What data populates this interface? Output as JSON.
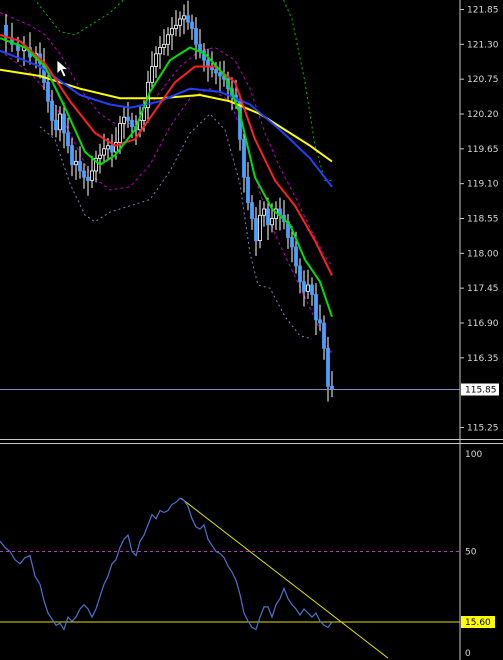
{
  "chart_data": [
    {
      "type": "candlestick",
      "panel": "price",
      "ylim": [
        115.1,
        122.0
      ],
      "yticks": [
        "121.85",
        "121.30",
        "120.75",
        "120.20",
        "119.65",
        "119.10",
        "118.55",
        "118.00",
        "117.45",
        "116.90",
        "116.35",
        "115.85",
        "115.25"
      ],
      "current_price": "115.85",
      "current_price_value": 115.85,
      "colors": {
        "background": "#000000",
        "candle": "#ffffff",
        "bollinger": "#00c000",
        "envelope": "#c000c0",
        "ema_fast": "#00e000",
        "ema_mid": "#ff2020",
        "ma_slow": "#2040ff",
        "ma_long": "#ffff00",
        "price_line": "#7f8fbf"
      },
      "close_path": [
        [
          0,
          121.6
        ],
        [
          6,
          121.4
        ],
        [
          12,
          121.3
        ],
        [
          18,
          121.2
        ],
        [
          24,
          121.25
        ],
        [
          30,
          121.1
        ],
        [
          36,
          121.15
        ],
        [
          40,
          121.0
        ],
        [
          44,
          120.7
        ],
        [
          48,
          120.4
        ],
        [
          52,
          120.1
        ],
        [
          56,
          119.95
        ],
        [
          60,
          120.2
        ],
        [
          64,
          119.9
        ],
        [
          68,
          119.7
        ],
        [
          72,
          119.4
        ],
        [
          76,
          119.45
        ],
        [
          80,
          119.3
        ],
        [
          84,
          119.2
        ],
        [
          88,
          119.15
        ],
        [
          92,
          119.3
        ],
        [
          96,
          119.5
        ],
        [
          100,
          119.55
        ],
        [
          104,
          119.65
        ],
        [
          108,
          119.7
        ],
        [
          112,
          119.6
        ],
        [
          116,
          119.75
        ],
        [
          120,
          120.05
        ],
        [
          124,
          120.15
        ],
        [
          128,
          120.1
        ],
        [
          132,
          120.0
        ],
        [
          136,
          119.95
        ],
        [
          140,
          120.1
        ],
        [
          144,
          120.3
        ],
        [
          148,
          120.7
        ],
        [
          152,
          120.95
        ],
        [
          156,
          121.15
        ],
        [
          160,
          121.25
        ],
        [
          164,
          121.3
        ],
        [
          168,
          121.45
        ],
        [
          172,
          121.55
        ],
        [
          176,
          121.6
        ],
        [
          180,
          121.7
        ],
        [
          184,
          121.75
        ],
        [
          188,
          121.65
        ],
        [
          192,
          121.55
        ],
        [
          196,
          121.3
        ],
        [
          200,
          121.2
        ],
        [
          204,
          121.05
        ],
        [
          208,
          120.95
        ],
        [
          212,
          120.9
        ],
        [
          216,
          120.85
        ],
        [
          220,
          120.8
        ],
        [
          224,
          120.75
        ],
        [
          228,
          120.6
        ],
        [
          232,
          120.5
        ],
        [
          236,
          120.4
        ],
        [
          240,
          119.8
        ],
        [
          244,
          119.2
        ],
        [
          248,
          118.8
        ],
        [
          252,
          118.55
        ],
        [
          256,
          118.2
        ],
        [
          260,
          118.6
        ],
        [
          264,
          118.7
        ],
        [
          268,
          118.45
        ],
        [
          272,
          118.55
        ],
        [
          276,
          118.7
        ],
        [
          280,
          118.6
        ],
        [
          284,
          118.5
        ],
        [
          288,
          118.25
        ],
        [
          292,
          118.1
        ],
        [
          296,
          117.8
        ],
        [
          300,
          117.55
        ],
        [
          304,
          117.4
        ],
        [
          308,
          117.5
        ],
        [
          312,
          117.35
        ],
        [
          316,
          116.95
        ],
        [
          320,
          116.9
        ],
        [
          324,
          116.5
        ],
        [
          328,
          115.9
        ],
        [
          332,
          115.85
        ]
      ],
      "ma_long": [
        [
          0,
          120.9
        ],
        [
          40,
          120.8
        ],
        [
          80,
          120.6
        ],
        [
          120,
          120.45
        ],
        [
          160,
          120.45
        ],
        [
          200,
          120.5
        ],
        [
          230,
          120.4
        ],
        [
          260,
          120.2
        ],
        [
          290,
          119.9
        ],
        [
          310,
          119.7
        ],
        [
          332,
          119.45
        ]
      ],
      "ma_slow": [
        [
          0,
          121.2
        ],
        [
          40,
          120.95
        ],
        [
          80,
          120.5
        ],
        [
          110,
          120.35
        ],
        [
          130,
          120.3
        ],
        [
          160,
          120.4
        ],
        [
          190,
          120.6
        ],
        [
          220,
          120.55
        ],
        [
          250,
          120.35
        ],
        [
          280,
          119.95
        ],
        [
          310,
          119.5
        ],
        [
          332,
          119.05
        ]
      ],
      "ema_mid": [
        [
          0,
          121.45
        ],
        [
          20,
          121.35
        ],
        [
          45,
          121.0
        ],
        [
          70,
          120.4
        ],
        [
          95,
          119.9
        ],
        [
          115,
          119.7
        ],
        [
          135,
          119.8
        ],
        [
          155,
          120.25
        ],
        [
          175,
          120.7
        ],
        [
          195,
          120.95
        ],
        [
          215,
          120.95
        ],
        [
          235,
          120.7
        ],
        [
          255,
          119.8
        ],
        [
          275,
          119.15
        ],
        [
          295,
          118.75
        ],
        [
          315,
          118.2
        ],
        [
          332,
          117.65
        ]
      ],
      "ema_fast": [
        [
          0,
          121.4
        ],
        [
          25,
          121.25
        ],
        [
          45,
          120.95
        ],
        [
          65,
          120.3
        ],
        [
          85,
          119.6
        ],
        [
          100,
          119.4
        ],
        [
          115,
          119.55
        ],
        [
          135,
          119.95
        ],
        [
          150,
          120.55
        ],
        [
          170,
          121.05
        ],
        [
          190,
          121.25
        ],
        [
          205,
          121.15
        ],
        [
          225,
          120.8
        ],
        [
          240,
          120.2
        ],
        [
          255,
          119.2
        ],
        [
          272,
          118.7
        ],
        [
          290,
          118.45
        ],
        [
          305,
          117.9
        ],
        [
          320,
          117.55
        ],
        [
          332,
          117.0
        ]
      ],
      "bb_upper": [
        [
          0,
          122.6
        ],
        [
          20,
          122.3
        ],
        [
          40,
          121.9
        ],
        [
          60,
          121.5
        ],
        [
          75,
          121.45
        ],
        [
          90,
          121.6
        ],
        [
          110,
          121.8
        ],
        [
          130,
          122.1
        ],
        [
          150,
          122.4
        ],
        [
          170,
          122.6
        ],
        [
          195,
          122.5
        ],
        [
          215,
          122.15
        ],
        [
          235,
          122.05
        ],
        [
          250,
          122.2
        ],
        [
          262,
          122.4
        ],
        [
          275,
          122.3
        ],
        [
          292,
          121.7
        ],
        [
          305,
          120.7
        ],
        [
          315,
          119.7
        ],
        [
          325,
          119.15
        ],
        [
          332,
          119.15
        ]
      ],
      "bb_lower": [
        [
          40,
          120.0
        ],
        [
          55,
          119.8
        ],
        [
          70,
          119.1
        ],
        [
          85,
          118.6
        ],
        [
          95,
          118.5
        ],
        [
          110,
          118.65
        ],
        [
          130,
          118.75
        ],
        [
          150,
          118.85
        ],
        [
          170,
          119.3
        ],
        [
          190,
          119.9
        ],
        [
          210,
          120.2
        ],
        [
          225,
          119.95
        ],
        [
          240,
          119.1
        ],
        [
          250,
          118.0
        ],
        [
          258,
          117.5
        ],
        [
          270,
          117.45
        ],
        [
          285,
          117.0
        ],
        [
          300,
          116.7
        ],
        [
          312,
          116.65
        ]
      ],
      "env_upper": [
        [
          0,
          121.8
        ],
        [
          30,
          121.6
        ],
        [
          45,
          121.45
        ],
        [
          60,
          121.15
        ],
        [
          80,
          120.6
        ],
        [
          100,
          120.2
        ],
        [
          120,
          120.0
        ],
        [
          140,
          120.1
        ],
        [
          160,
          120.55
        ],
        [
          180,
          120.95
        ],
        [
          200,
          121.2
        ],
        [
          215,
          121.25
        ],
        [
          235,
          121.05
        ],
        [
          250,
          120.6
        ],
        [
          265,
          119.9
        ],
        [
          280,
          119.35
        ],
        [
          295,
          118.9
        ],
        [
          310,
          118.4
        ],
        [
          325,
          117.95
        ],
        [
          332,
          117.8
        ]
      ],
      "env_lower": [
        [
          0,
          121.2
        ],
        [
          30,
          120.85
        ],
        [
          50,
          120.5
        ],
        [
          70,
          119.9
        ],
        [
          90,
          119.25
        ],
        [
          110,
          119.0
        ],
        [
          130,
          119.05
        ],
        [
          150,
          119.4
        ],
        [
          170,
          120.0
        ],
        [
          190,
          120.45
        ],
        [
          210,
          120.6
        ],
        [
          230,
          120.4
        ],
        [
          245,
          119.8
        ],
        [
          260,
          118.95
        ],
        [
          275,
          118.3
        ],
        [
          290,
          117.8
        ],
        [
          305,
          117.3
        ],
        [
          320,
          116.8
        ],
        [
          332,
          116.4
        ]
      ]
    },
    {
      "type": "line",
      "panel": "oscillator",
      "ylim": [
        0,
        100
      ],
      "yticks": [
        "100",
        "50",
        "0"
      ],
      "level": 50,
      "current_value": "15.60",
      "current_value_num": 15.6,
      "colors": {
        "line": "#5070d0",
        "level": "#b040b0",
        "current": "#e0e000",
        "trend": "#e0e000"
      },
      "trendline": [
        [
          181,
          76
        ],
        [
          388,
          -2
        ]
      ],
      "points": [
        [
          0,
          55
        ],
        [
          5,
          52
        ],
        [
          10,
          50
        ],
        [
          15,
          46
        ],
        [
          20,
          44
        ],
        [
          25,
          47
        ],
        [
          30,
          48
        ],
        [
          35,
          38
        ],
        [
          40,
          34
        ],
        [
          44,
          26
        ],
        [
          48,
          20
        ],
        [
          52,
          17
        ],
        [
          56,
          14
        ],
        [
          60,
          15
        ],
        [
          64,
          12
        ],
        [
          68,
          18
        ],
        [
          72,
          16
        ],
        [
          76,
          18
        ],
        [
          80,
          22
        ],
        [
          84,
          24
        ],
        [
          88,
          22
        ],
        [
          92,
          18
        ],
        [
          96,
          22
        ],
        [
          100,
          28
        ],
        [
          104,
          34
        ],
        [
          108,
          38
        ],
        [
          112,
          44
        ],
        [
          116,
          46
        ],
        [
          120,
          52
        ],
        [
          124,
          56
        ],
        [
          128,
          58
        ],
        [
          132,
          50
        ],
        [
          136,
          48
        ],
        [
          140,
          55
        ],
        [
          144,
          58
        ],
        [
          148,
          63
        ],
        [
          152,
          68
        ],
        [
          156,
          66
        ],
        [
          160,
          70
        ],
        [
          164,
          69
        ],
        [
          168,
          70
        ],
        [
          172,
          73
        ],
        [
          176,
          74
        ],
        [
          180,
          76
        ],
        [
          184,
          75
        ],
        [
          188,
          72
        ],
        [
          192,
          66
        ],
        [
          196,
          62
        ],
        [
          200,
          61
        ],
        [
          204,
          63
        ],
        [
          208,
          56
        ],
        [
          212,
          53
        ],
        [
          216,
          50
        ],
        [
          220,
          49
        ],
        [
          224,
          47
        ],
        [
          228,
          43
        ],
        [
          232,
          40
        ],
        [
          236,
          36
        ],
        [
          240,
          29
        ],
        [
          244,
          20
        ],
        [
          248,
          16
        ],
        [
          252,
          13
        ],
        [
          256,
          12
        ],
        [
          260,
          18
        ],
        [
          264,
          23
        ],
        [
          268,
          23
        ],
        [
          272,
          18
        ],
        [
          276,
          24
        ],
        [
          280,
          27
        ],
        [
          284,
          32
        ],
        [
          288,
          27
        ],
        [
          292,
          24
        ],
        [
          296,
          22
        ],
        [
          300,
          19
        ],
        [
          304,
          22
        ],
        [
          308,
          20
        ],
        [
          312,
          18
        ],
        [
          316,
          20
        ],
        [
          320,
          16
        ],
        [
          324,
          14
        ],
        [
          328,
          13
        ],
        [
          332,
          15.6
        ]
      ]
    }
  ]
}
